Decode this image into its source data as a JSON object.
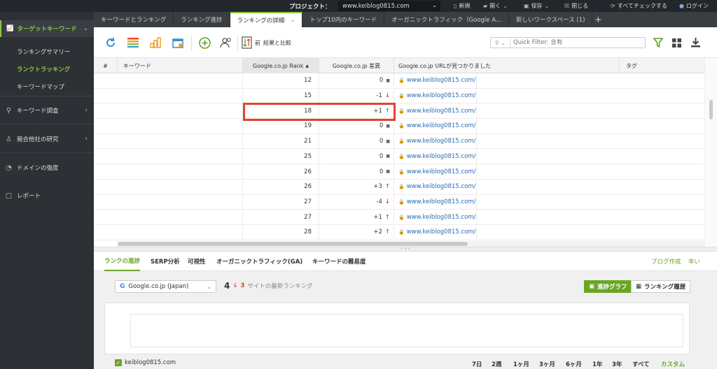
{
  "topbar": {
    "project_label": "プロジェクト：",
    "project_value": "www.keiblog0815.com",
    "new": "新規",
    "open": "開く",
    "save": "保存",
    "close": "閉じる",
    "check_all": "すべてチェックする",
    "login": "ログイン"
  },
  "sidebar": {
    "head": "ターゲットキーワード",
    "sub": [
      "ランキングサマリー",
      "ランクトラッキング",
      "キーワードマップ"
    ],
    "items": [
      "キーワード調査",
      "競合他社の研究",
      "ドメインの強度",
      "レポート"
    ]
  },
  "tabs": [
    "キーワードとランキング",
    "ランキング進捗",
    "ランキングの詳細",
    "トップ10内のキーワード",
    "オーガニックトラフィック（Google A...",
    "新しいワークスペース (1)"
  ],
  "toolbar": {
    "compare_prefix": "前",
    "compare_label": "結果と比較",
    "quick_filter_placeholder": "Quick Filter: 含有"
  },
  "grid": {
    "headers": {
      "num": "#",
      "keyword": "キーワード",
      "rank": "Google.co.jp Rank",
      "diff": "Google.co.jp 差異",
      "url": "Google.co.jp URLが見つかりました",
      "tag": "タグ"
    },
    "rows": [
      {
        "rank": "12",
        "diff": "0",
        "dir": "none",
        "url": "www.keiblog0815.com/"
      },
      {
        "rank": "15",
        "diff": "-1",
        "dir": "down",
        "url": "www.keiblog0815.com/"
      },
      {
        "rank": "18",
        "diff": "+1",
        "dir": "up",
        "url": "www.keiblog0815.com/"
      },
      {
        "rank": "19",
        "diff": "0",
        "dir": "none",
        "url": "www.keiblog0815.com/"
      },
      {
        "rank": "21",
        "diff": "0",
        "dir": "none",
        "url": "www.keiblog0815.com/"
      },
      {
        "rank": "25",
        "diff": "0",
        "dir": "none",
        "url": "www.keiblog0815.com/"
      },
      {
        "rank": "26",
        "diff": "0",
        "dir": "none",
        "url": "www.keiblog0815.com/"
      },
      {
        "rank": "26",
        "diff": "+3",
        "dir": "up",
        "url": "www.keiblog0815.com/"
      },
      {
        "rank": "27",
        "diff": "-4",
        "dir": "down",
        "url": "www.keiblog0815.com/"
      },
      {
        "rank": "27",
        "diff": "+1",
        "dir": "up",
        "url": "www.keiblog0815.com/"
      },
      {
        "rank": "28",
        "diff": "+2",
        "dir": "up",
        "url": "www.keiblog0815.com/"
      }
    ]
  },
  "bottom_tabs": [
    "ランクの進捗",
    "SERP分析",
    "可視性",
    "オーガニックトラフィック(GA)",
    "キーワードの難易度"
  ],
  "bottom_right": {
    "blog": "ブログ作成",
    "link": "辛い"
  },
  "panel": {
    "engine": "Google.co.jp (Japan)",
    "rank": "4",
    "change": "3",
    "rank_text": "サイトの最新ランキング",
    "graph_btn": "進捗グラフ",
    "history_btn": "ランキング履歴",
    "legend": "keiblog0815.com",
    "ranges": [
      "7日",
      "2週",
      "1ヶ月",
      "3ヶ月",
      "6ヶ月",
      "1年",
      "3年",
      "すべて",
      "カスタム"
    ]
  },
  "colors": {
    "accent": "#8cc63f",
    "up": "#5aa02c",
    "down": "#d9472b",
    "highlight": "#e0432e"
  }
}
